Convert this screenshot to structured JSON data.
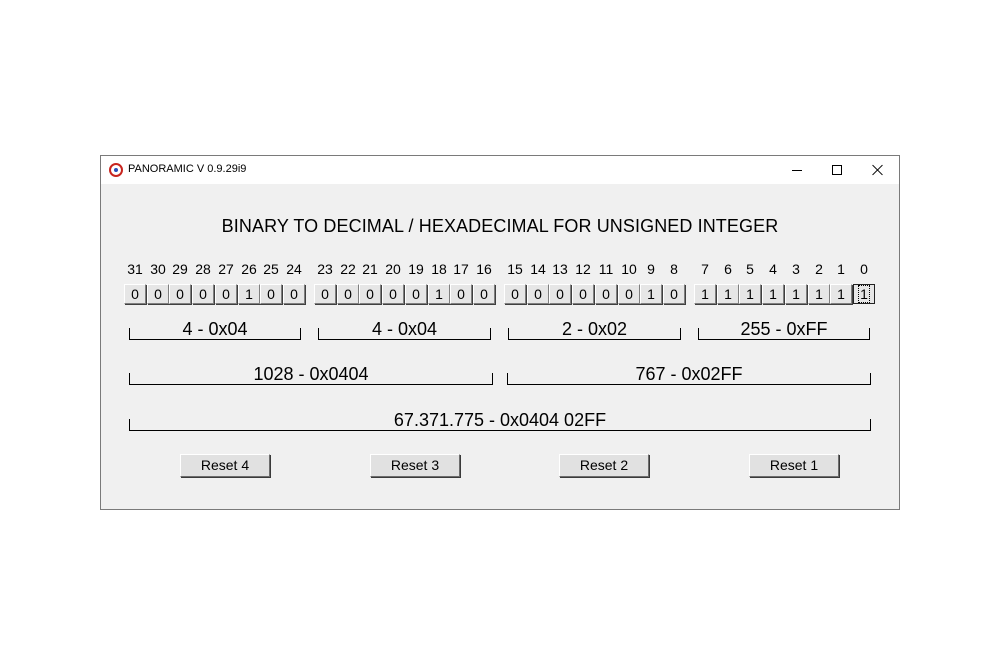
{
  "window": {
    "title": "PANORAMIC V 0.9.29i9",
    "heading": "BINARY TO DECIMAL / HEXADECIMAL FOR UNSIGNED INTEGER"
  },
  "bit_positions": [
    "31",
    "30",
    "29",
    "28",
    "27",
    "26",
    "25",
    "24",
    "23",
    "22",
    "21",
    "20",
    "19",
    "18",
    "17",
    "16",
    "15",
    "14",
    "13",
    "12",
    "11",
    "10",
    "9",
    "8",
    "7",
    "6",
    "5",
    "4",
    "3",
    "2",
    "1",
    "0"
  ],
  "bit_values": [
    "0",
    "0",
    "0",
    "0",
    "0",
    "1",
    "0",
    "0",
    "0",
    "0",
    "0",
    "0",
    "0",
    "1",
    "0",
    "0",
    "0",
    "0",
    "0",
    "0",
    "0",
    "0",
    "1",
    "0",
    "1",
    "1",
    "1",
    "1",
    "1",
    "1",
    "1",
    "1"
  ],
  "byte_labels": [
    "4 - 0x04",
    "4 - 0x04",
    "2 - 0x02",
    "255 - 0xFF"
  ],
  "word_labels": [
    "1028 - 0x0404",
    "767 - 0x02FF"
  ],
  "dword_label": "67.371.775 - 0x0404 02FF",
  "reset_buttons": [
    "Reset 4",
    "Reset 3",
    "Reset 2",
    "Reset 1"
  ],
  "colors": {
    "window_bg": "#f0f0f0",
    "titlebar_bg": "#ffffff",
    "icon_red": "#c8251f"
  }
}
